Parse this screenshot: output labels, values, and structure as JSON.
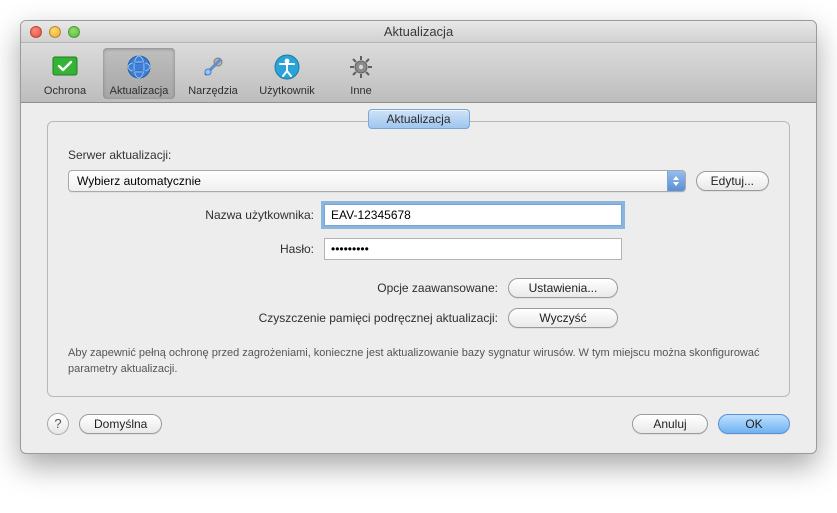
{
  "window": {
    "title": "Aktualizacja"
  },
  "toolbar": {
    "items": [
      {
        "label": "Ochrona"
      },
      {
        "label": "Aktualizacja"
      },
      {
        "label": "Narzędzia"
      },
      {
        "label": "Użytkownik"
      },
      {
        "label": "Inne"
      }
    ],
    "selected_index": 1
  },
  "group": {
    "tab": "Aktualizacja"
  },
  "server": {
    "label": "Serwer aktualizacji:",
    "selected": "Wybierz automatycznie",
    "edit_btn": "Edytuj..."
  },
  "credentials": {
    "user_label": "Nazwa użytkownika:",
    "user_value": "EAV-12345678",
    "pass_label": "Hasło:",
    "pass_value": "•••••••••"
  },
  "advanced": {
    "label": "Opcje zaawansowane:",
    "btn": "Ustawienia..."
  },
  "cache": {
    "label": "Czyszczenie pamięci podręcznej aktualizacji:",
    "btn": "Wyczyść"
  },
  "footnote": "Aby zapewnić pełną ochronę przed zagrożeniami, konieczne jest aktualizowanie bazy sygnatur wirusów. W tym miejscu można skonfigurować parametry aktualizacji.",
  "buttons": {
    "help": "?",
    "default": "Domyślna",
    "cancel": "Anuluj",
    "ok": "OK"
  }
}
